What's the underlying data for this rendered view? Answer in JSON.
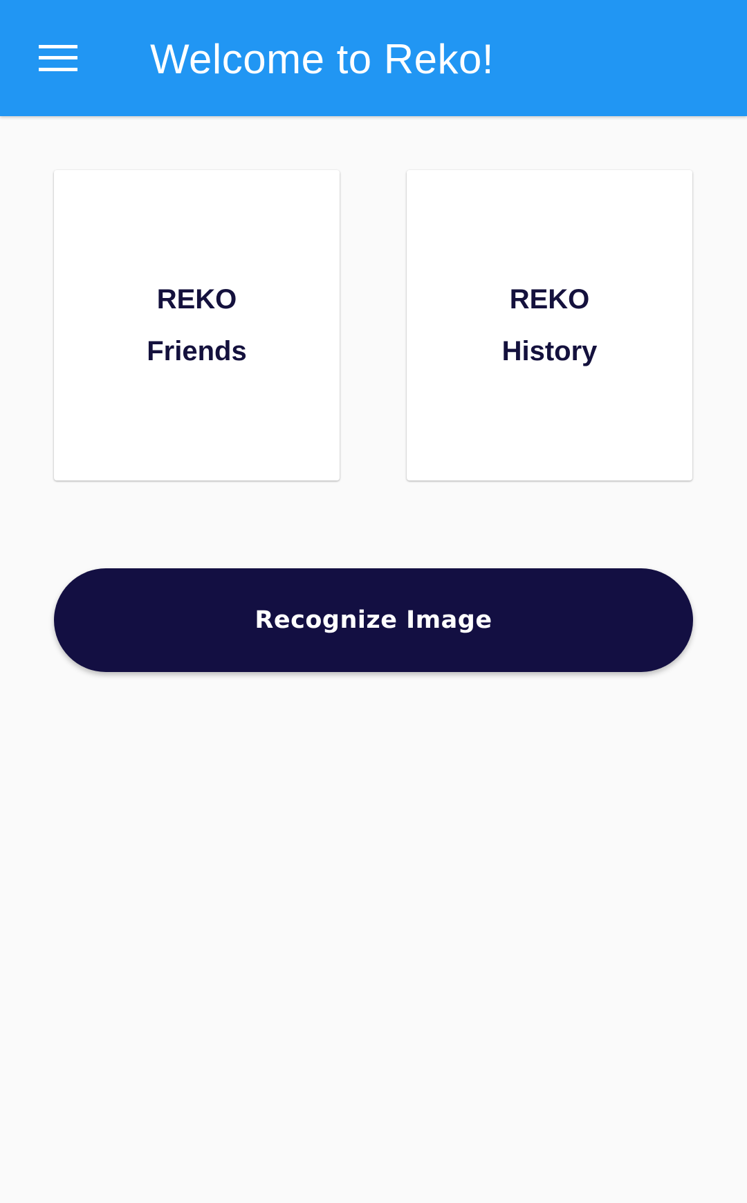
{
  "app_bar": {
    "title": "Welcome to Reko!",
    "menu_icon": "hamburger-menu-icon",
    "background_color": "#2196f3"
  },
  "cards": [
    {
      "line1": "REKO",
      "line2": "Friends"
    },
    {
      "line1": "REKO",
      "line2": "History"
    }
  ],
  "primary_action": {
    "label": "Recognize Image",
    "background_color": "#130f42"
  },
  "colors": {
    "page_background": "#fafafa",
    "card_text": "#14113d"
  }
}
